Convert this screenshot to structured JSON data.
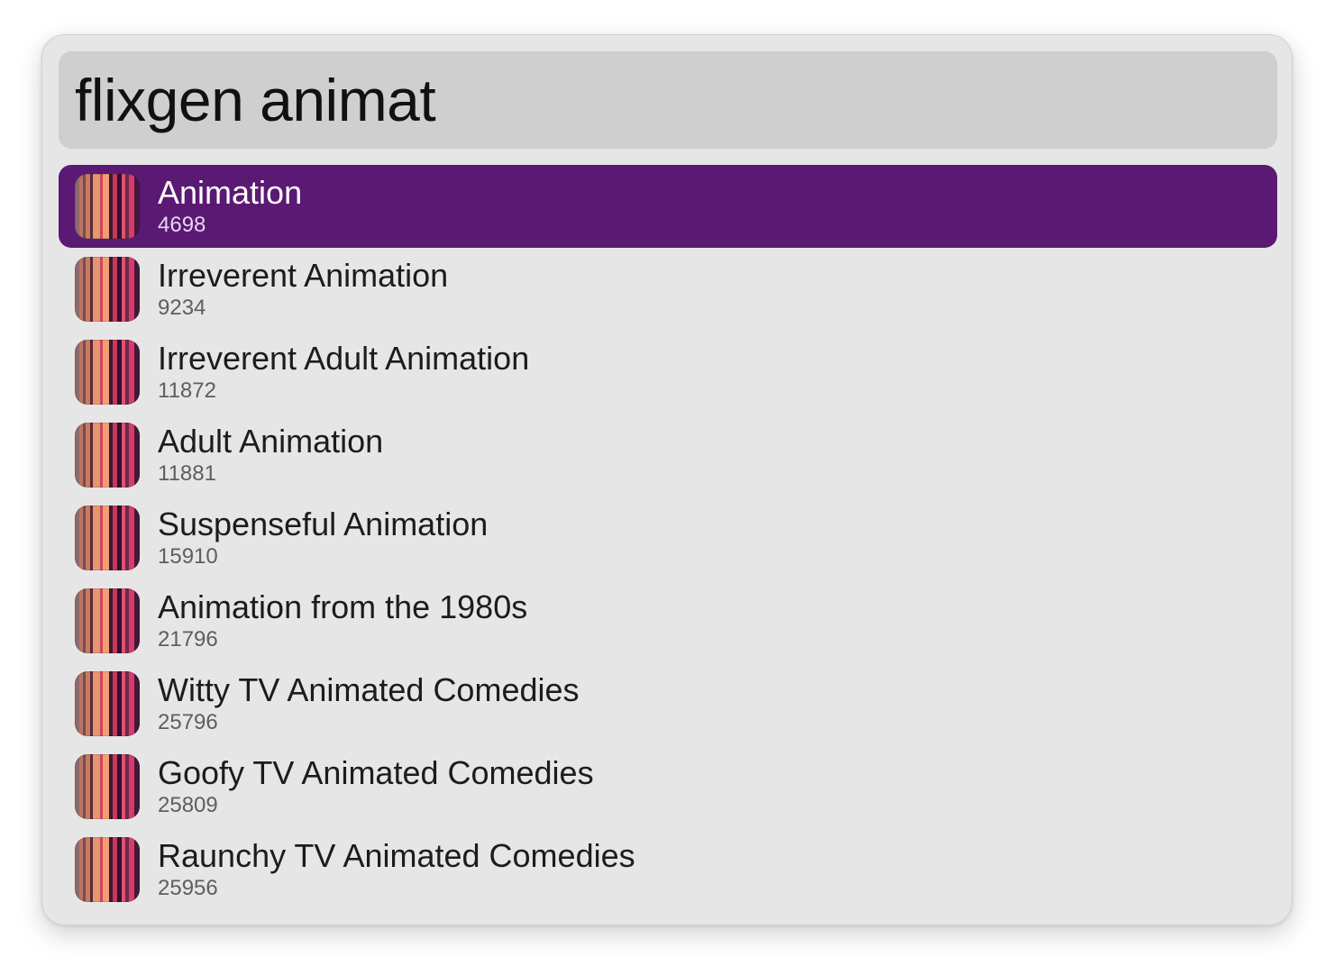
{
  "search": {
    "query": "flixgen animat"
  },
  "results": [
    {
      "title": "Animation",
      "count": "4698",
      "selected": true,
      "icon": "genre-stripes-icon"
    },
    {
      "title": "Irreverent Animation",
      "count": "9234",
      "selected": false,
      "icon": "genre-stripes-icon"
    },
    {
      "title": "Irreverent Adult Animation",
      "count": "11872",
      "selected": false,
      "icon": "genre-stripes-icon"
    },
    {
      "title": "Adult Animation",
      "count": "11881",
      "selected": false,
      "icon": "genre-stripes-icon"
    },
    {
      "title": "Suspenseful Animation",
      "count": "15910",
      "selected": false,
      "icon": "genre-stripes-icon"
    },
    {
      "title": "Animation from the 1980s",
      "count": "21796",
      "selected": false,
      "icon": "genre-stripes-icon"
    },
    {
      "title": "Witty TV Animated Comedies",
      "count": "25796",
      "selected": false,
      "icon": "genre-stripes-icon"
    },
    {
      "title": "Goofy TV Animated Comedies",
      "count": "25809",
      "selected": false,
      "icon": "genre-stripes-icon"
    },
    {
      "title": "Raunchy TV Animated Comedies",
      "count": "25956",
      "selected": false,
      "icon": "genre-stripes-icon"
    }
  ],
  "colors": {
    "selection": "#5a1973",
    "window_bg": "#e6e6e6",
    "search_bg": "#cfcfcf"
  }
}
